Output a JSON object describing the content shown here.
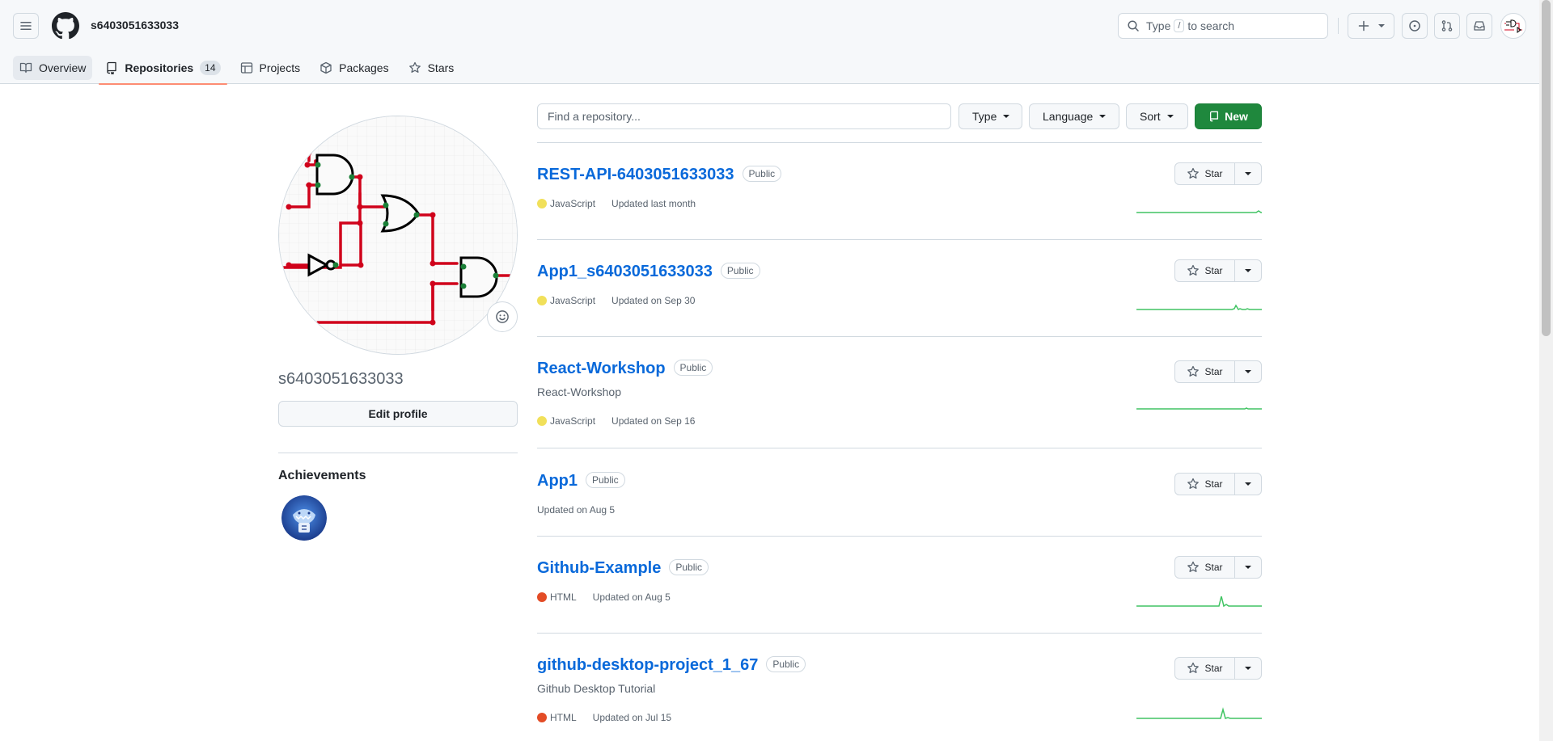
{
  "header": {
    "context_username": "s6403051633033",
    "search": {
      "prefix": "Type",
      "key": "/",
      "suffix": "to search"
    }
  },
  "tabs": [
    {
      "label": "Overview",
      "icon": "book-icon"
    },
    {
      "label": "Repositories",
      "icon": "repo-icon",
      "count": "14"
    },
    {
      "label": "Projects",
      "icon": "table-icon"
    },
    {
      "label": "Packages",
      "icon": "package-icon"
    },
    {
      "label": "Stars",
      "icon": "star-icon"
    }
  ],
  "sidebar": {
    "login": "s6403051633033",
    "edit_profile_label": "Edit profile",
    "achievements_title": "Achievements"
  },
  "filters": {
    "search_placeholder": "Find a repository...",
    "type_label": "Type",
    "language_label": "Language",
    "sort_label": "Sort",
    "new_label": "New"
  },
  "repos": [
    {
      "name": "REST-API-6403051633033",
      "visibility": "Public",
      "description": "",
      "language": "JavaScript",
      "language_color": "#f1e05a",
      "updated": "Updated last month",
      "star_label": "Star"
    },
    {
      "name": "App1_s6403051633033",
      "visibility": "Public",
      "description": "",
      "language": "JavaScript",
      "language_color": "#f1e05a",
      "updated": "Updated on Sep 30",
      "star_label": "Star"
    },
    {
      "name": "React-Workshop",
      "visibility": "Public",
      "description": "React-Workshop",
      "language": "JavaScript",
      "language_color": "#f1e05a",
      "updated": "Updated on Sep 16",
      "star_label": "Star"
    },
    {
      "name": "App1",
      "visibility": "Public",
      "description": "",
      "language": "",
      "language_color": "",
      "updated": "Updated on Aug 5",
      "star_label": "Star"
    },
    {
      "name": "Github-Example",
      "visibility": "Public",
      "description": "",
      "language": "HTML",
      "language_color": "#e34c26",
      "updated": "Updated on Aug 5",
      "star_label": "Star"
    },
    {
      "name": "github-desktop-project_1_67",
      "visibility": "Public",
      "description": "Github Desktop Tutorial",
      "language": "HTML",
      "language_color": "#e34c26",
      "updated": "Updated on Jul 15",
      "star_label": "Star"
    }
  ],
  "colors": {
    "accent_link": "#0969da",
    "primary_button": "#1f883d",
    "tab_underline": "#fd8c73",
    "sparkline": "#40c463"
  }
}
